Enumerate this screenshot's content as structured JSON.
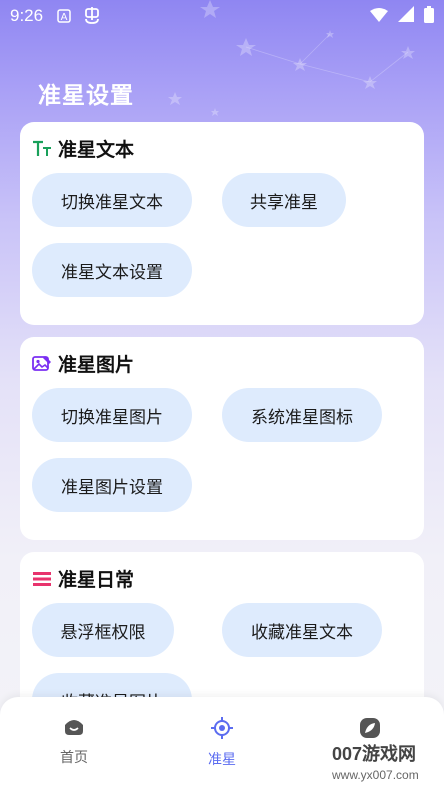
{
  "status_bar": {
    "time": "9:26"
  },
  "page": {
    "title": "准星设置"
  },
  "sections": [
    {
      "title": "准星文本",
      "icon": "text-size-icon",
      "icon_color": "#19a05a",
      "buttons": [
        "切换准星文本",
        "共享准星",
        "准星文本设置"
      ]
    },
    {
      "title": "准星图片",
      "icon": "image-edit-icon",
      "icon_color": "#7b2ff2",
      "buttons": [
        "切换准星图片",
        "系统准星图标",
        "准星图片设置"
      ]
    },
    {
      "title": "准星日常",
      "icon": "list-icon",
      "icon_color": "#e8336d",
      "buttons": [
        "悬浮框权限",
        "收藏准星文本",
        "收藏准星图片"
      ]
    }
  ],
  "bottom_nav": {
    "items": [
      {
        "label": "首页",
        "icon": "home-icon",
        "active": false
      },
      {
        "label": "准星",
        "icon": "crosshair-icon",
        "active": true
      },
      {
        "label": "",
        "icon": "leaf-icon",
        "active": false
      }
    ],
    "active_color": "#5b6cf0",
    "inactive_color": "#666666"
  },
  "watermark": {
    "main": "007游戏网",
    "url": "www.yx007.com"
  },
  "colors": {
    "pill_bg": "#deebfd",
    "header_gradient_top": "#8f86f2"
  }
}
